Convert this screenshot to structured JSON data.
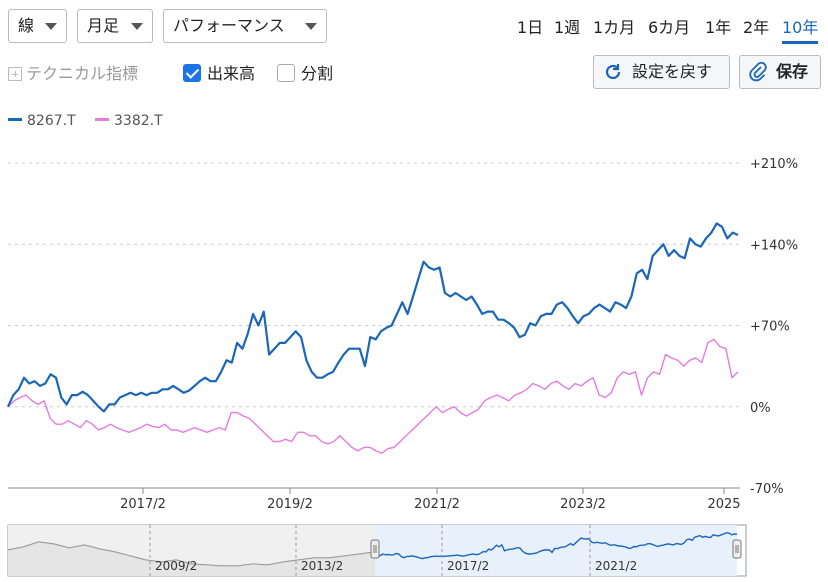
{
  "controls": {
    "chart_type": "線",
    "interval": "月足",
    "mode": "パフォーマンス",
    "ranges": [
      "1日",
      "1週",
      "1カ月",
      "6カ月",
      "1年",
      "2年",
      "10年"
    ],
    "active_range": "10年",
    "technical_label": "テクニカル指標",
    "volume_label": "出来高",
    "split_label": "分割",
    "reset_label": "設定を戻す",
    "save_label": "保存"
  },
  "chart_data": {
    "type": "line",
    "x_ticks": [
      "2017/2",
      "2019/2",
      "2021/2",
      "2023/2",
      "2025"
    ],
    "y_ticks": [
      "+210%",
      "+140%",
      "+70%",
      "0%",
      "-70%"
    ],
    "ylim": [
      -70,
      210
    ],
    "grid": true,
    "legend_position": "top-left",
    "series": [
      {
        "name": "8267.T",
        "color": "#1a66b8",
        "values": [
          0,
          10,
          15,
          25,
          20,
          22,
          18,
          20,
          28,
          25,
          8,
          2,
          10,
          10,
          13,
          10,
          5,
          0,
          -4,
          2,
          2,
          8,
          10,
          12,
          10,
          12,
          10,
          12,
          12,
          15,
          15,
          18,
          15,
          12,
          14,
          18,
          22,
          25,
          22,
          22,
          30,
          40,
          38,
          55,
          50,
          63,
          80,
          70,
          82,
          45,
          50,
          55,
          55,
          60,
          65,
          60,
          40,
          30,
          25,
          25,
          28,
          30,
          38,
          45,
          50,
          50,
          50,
          35,
          60,
          58,
          65,
          68,
          70,
          80,
          90,
          80,
          95,
          110,
          125,
          120,
          118,
          120,
          98,
          95,
          98,
          95,
          92,
          95,
          88,
          80,
          82,
          82,
          75,
          75,
          72,
          68,
          60,
          62,
          72,
          70,
          78,
          80,
          80,
          88,
          90,
          85,
          78,
          72,
          78,
          80,
          85,
          88,
          85,
          82,
          90,
          88,
          85,
          95,
          115,
          118,
          110,
          130,
          135,
          140,
          130,
          135,
          130,
          128,
          145,
          140,
          138,
          145,
          150,
          158,
          155,
          145,
          150,
          148
        ]
      },
      {
        "name": "3382.T",
        "color": "#e57be0",
        "values": [
          0,
          5,
          8,
          10,
          5,
          2,
          5,
          -10,
          -15,
          -15,
          -12,
          -15,
          -18,
          -12,
          -15,
          -20,
          -18,
          -15,
          -18,
          -20,
          -22,
          -20,
          -18,
          -15,
          -17,
          -18,
          -15,
          -20,
          -20,
          -22,
          -20,
          -18,
          -20,
          -22,
          -20,
          -18,
          -20,
          -5,
          -5,
          -8,
          -10,
          -15,
          -20,
          -25,
          -30,
          -30,
          -28,
          -30,
          -22,
          -22,
          -25,
          -25,
          -30,
          -32,
          -30,
          -25,
          -30,
          -35,
          -38,
          -35,
          -35,
          -38,
          -40,
          -36,
          -35,
          -30,
          -25,
          -20,
          -15,
          -10,
          -5,
          0,
          -5,
          -2,
          0,
          -5,
          -8,
          -5,
          -2,
          5,
          8,
          10,
          8,
          5,
          10,
          12,
          15,
          20,
          18,
          15,
          20,
          22,
          18,
          15,
          20,
          18,
          22,
          25,
          10,
          8,
          12,
          25,
          30,
          28,
          30,
          10,
          25,
          30,
          28,
          45,
          42,
          40,
          35,
          40,
          42,
          38,
          55,
          58,
          52,
          50,
          25,
          30
        ]
      }
    ]
  },
  "navigator": {
    "x_ticks": [
      "2009/2",
      "2013/2",
      "2017/2",
      "2021/2"
    ]
  }
}
